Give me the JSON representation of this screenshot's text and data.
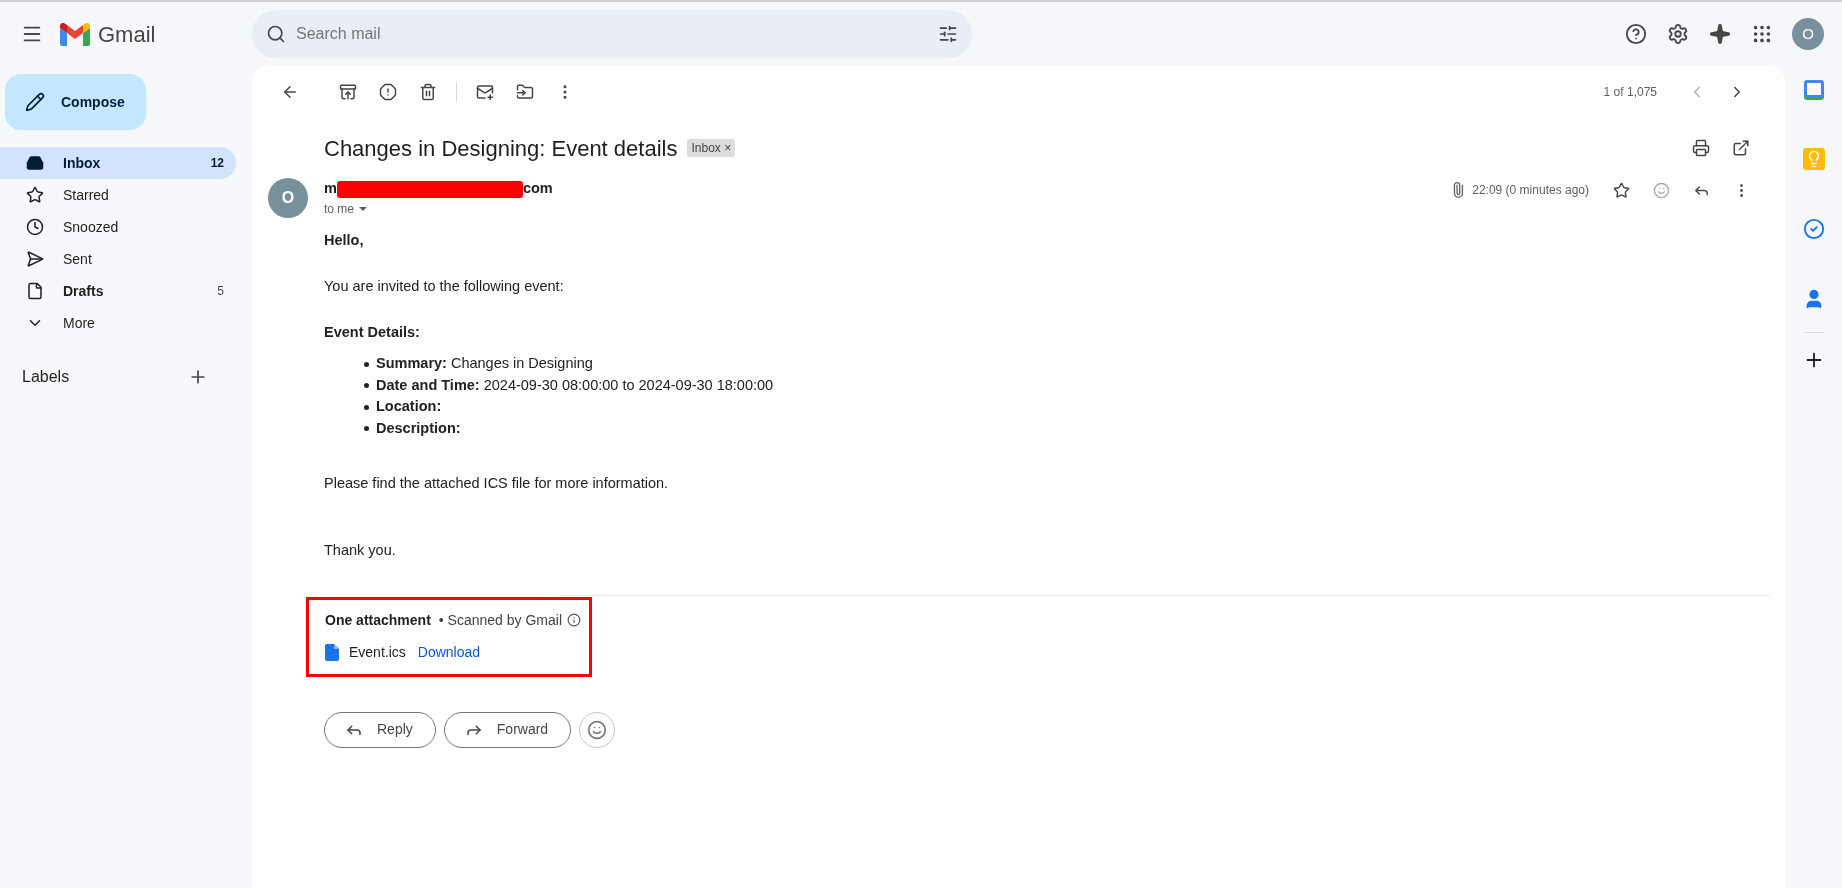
{
  "app": {
    "name": "Gmail"
  },
  "search": {
    "placeholder": "Search mail"
  },
  "account": {
    "initial": "O"
  },
  "compose": {
    "label": "Compose"
  },
  "nav": [
    {
      "label": "Inbox",
      "count": "12",
      "selected": true,
      "bold": true
    },
    {
      "label": "Starred",
      "selected": false,
      "bold": false
    },
    {
      "label": "Snoozed",
      "selected": false,
      "bold": false
    },
    {
      "label": "Sent",
      "selected": false,
      "bold": false
    },
    {
      "label": "Drafts",
      "count": "5",
      "selected": false,
      "bold": true
    },
    {
      "label": "More",
      "selected": false,
      "bold": false
    }
  ],
  "labels_heading": "Labels",
  "pager": "1 of 1,075",
  "subject": "Changes in Designing: Event details",
  "chip": {
    "label": "Inbox",
    "close": "×"
  },
  "message": {
    "avatar": "O",
    "sender_start": "m",
    "sender_end": "com",
    "redacted": true,
    "recipient": "to me",
    "time": "22:09 (0 minutes ago)"
  },
  "body": [
    {
      "kind": "bold",
      "text": "Hello,"
    },
    {
      "kind": "paragraph",
      "text": "You are invited to the following event:"
    },
    {
      "kind": "bold",
      "text": "Event Details:"
    },
    {
      "kind": "list",
      "items": [
        "**Summary:** Changes in Designing",
        "**Date and Time:** 2024-09-30 08:00:00 to 2024-09-30 18:00:00",
        "**Location:**",
        "**Description:**"
      ]
    },
    {
      "kind": "paragraph",
      "text": "Please find the attached ICS file for more information."
    },
    {
      "kind": "paragraph",
      "text": "Thank you."
    }
  ],
  "attachments": {
    "title": "One attachment",
    "note": "• Scanned by Gmail",
    "highlighted": true,
    "files": [
      {
        "name": "Event.ics",
        "action": "Download"
      }
    ]
  },
  "actions": [
    {
      "label": "Reply"
    },
    {
      "label": "Forward"
    }
  ]
}
